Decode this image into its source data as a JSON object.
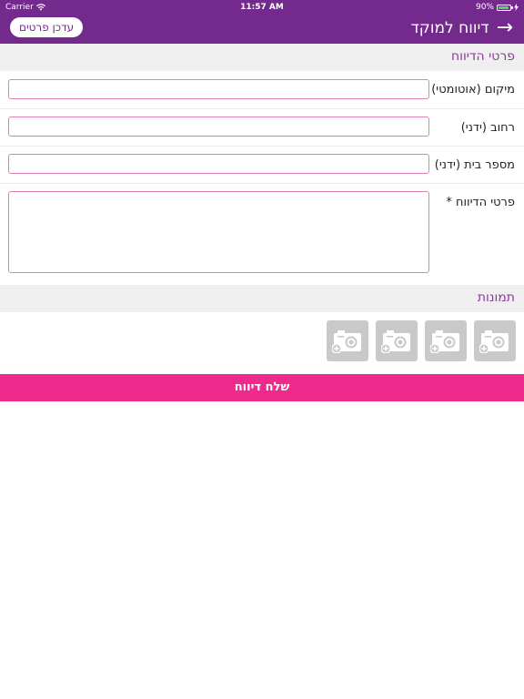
{
  "status_bar": {
    "carrier": "Carrier",
    "time": "11:57 AM",
    "battery": "90%",
    "battery_level": 0.9
  },
  "nav": {
    "title": "דיווח למוקד",
    "back_icon": "arrow-right-icon",
    "update_label": "עדכן פרטים"
  },
  "details_section": {
    "title": "פרטי הדיווח"
  },
  "fields": {
    "location": {
      "label": "מיקום (אוטומטי)",
      "value": ""
    },
    "street": {
      "label": "רחוב (ידני)",
      "value": ""
    },
    "house_number": {
      "label": "מספר בית (ידני)",
      "value": ""
    },
    "details": {
      "label": "פרטי הדיווח *",
      "value": ""
    }
  },
  "photos_section": {
    "title": "תמונות",
    "photo_icon": "add-photo-icon"
  },
  "submit": {
    "label": "שלח דיווח"
  },
  "colors": {
    "header": "#732a8c",
    "accent": "#ef2a8d",
    "field_border": "#e17fbf",
    "section_text": "#8e3a9d"
  }
}
